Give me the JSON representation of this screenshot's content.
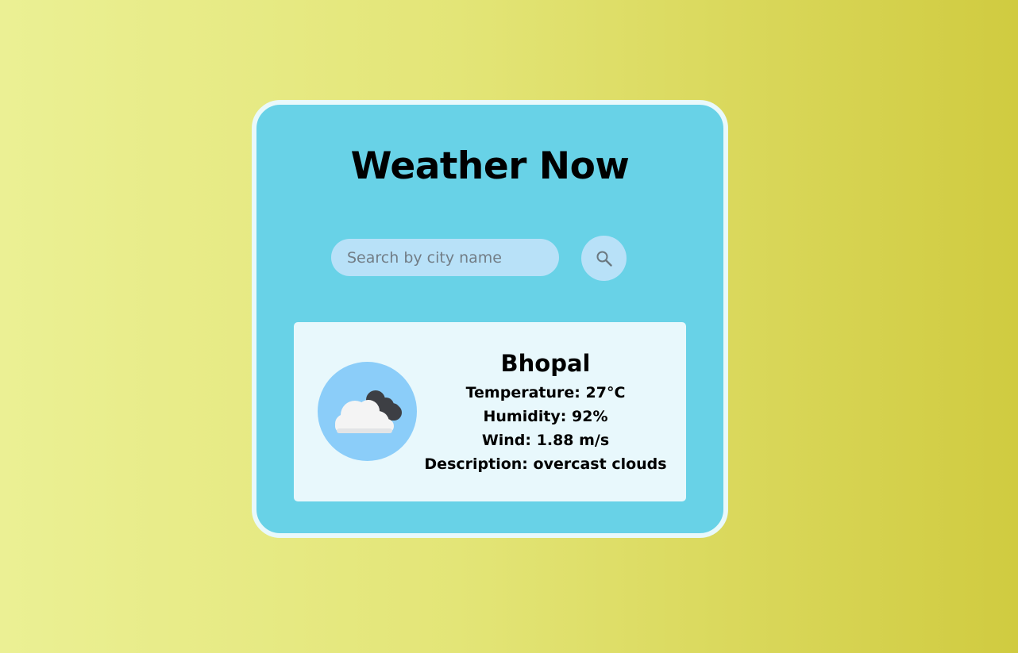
{
  "app": {
    "title": "Weather Now"
  },
  "search": {
    "placeholder": "Search by city name",
    "value": "",
    "button_icon": "search-icon"
  },
  "weather": {
    "city": "Bhopal",
    "icon": "overcast-clouds-icon",
    "temperature_label": "Temperature:",
    "temperature_value": "27°C",
    "humidity_label": "Humidity:",
    "humidity_value": "92%",
    "wind_label": "Wind:",
    "wind_value": "1.88 m/s",
    "description_label": "Description:",
    "description_value": "overcast clouds"
  },
  "colors": {
    "background_start": "#ebf094",
    "background_end": "#d0cb40",
    "card": "#68d2e7",
    "card_border": "#e9f9fb",
    "input": "#b8e1f8",
    "result_panel": "#e8f8fc",
    "icon_circle": "#8bcdf9"
  }
}
